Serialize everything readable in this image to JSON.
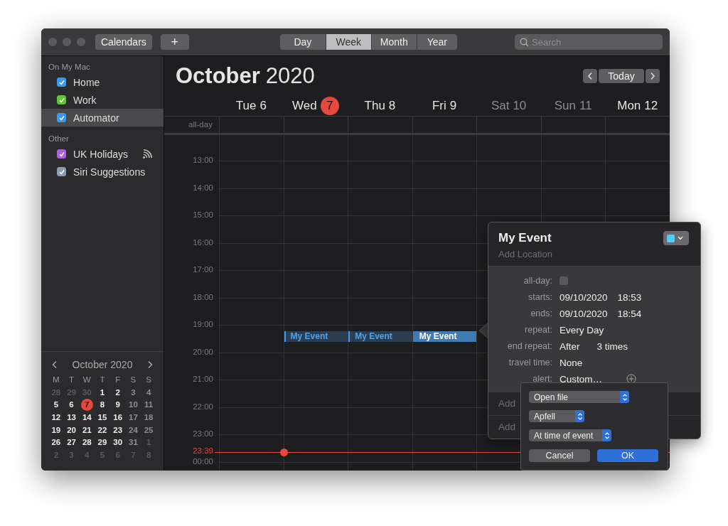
{
  "toolbar": {
    "calendars_button": "Calendars",
    "add_button": "+",
    "views": [
      {
        "label": "Day",
        "selected": false
      },
      {
        "label": "Week",
        "selected": true
      },
      {
        "label": "Month",
        "selected": false
      },
      {
        "label": "Year",
        "selected": false
      }
    ],
    "search": {
      "placeholder": "Search"
    }
  },
  "sidebar": {
    "groups": [
      {
        "title": "On My Mac",
        "items": [
          {
            "label": "Home",
            "color": "#3b99ee",
            "checked": true,
            "selected": false,
            "subscribed": false
          },
          {
            "label": "Work",
            "color": "#63c33a",
            "checked": true,
            "selected": false,
            "subscribed": false
          },
          {
            "label": "Automator",
            "color": "#3b99ee",
            "checked": true,
            "selected": true,
            "subscribed": false
          }
        ]
      },
      {
        "title": "Other",
        "items": [
          {
            "label": "UK Holidays",
            "color": "#b05fd6",
            "checked": true,
            "selected": false,
            "subscribed": true
          },
          {
            "label": "Siri Suggestions",
            "color": "#8d9ab3",
            "checked": true,
            "selected": false,
            "subscribed": false
          }
        ]
      }
    ]
  },
  "mini_calendar": {
    "title": "October 2020",
    "weekdays": [
      "M",
      "T",
      "W",
      "T",
      "F",
      "S",
      "S"
    ],
    "weeks": [
      [
        {
          "d": "28",
          "in_month": false,
          "today": false
        },
        {
          "d": "29",
          "in_month": false,
          "today": false
        },
        {
          "d": "30",
          "in_month": false,
          "today": false
        },
        {
          "d": "1",
          "in_month": true,
          "today": false
        },
        {
          "d": "2",
          "in_month": true,
          "today": false
        },
        {
          "d": "3",
          "in_month": true,
          "today": false
        },
        {
          "d": "4",
          "in_month": true,
          "today": false
        }
      ],
      [
        {
          "d": "5",
          "in_month": true,
          "today": false
        },
        {
          "d": "6",
          "in_month": true,
          "today": false
        },
        {
          "d": "7",
          "in_month": true,
          "today": true
        },
        {
          "d": "8",
          "in_month": true,
          "today": false
        },
        {
          "d": "9",
          "in_month": true,
          "today": false
        },
        {
          "d": "10",
          "in_month": true,
          "today": false
        },
        {
          "d": "11",
          "in_month": true,
          "today": false
        }
      ],
      [
        {
          "d": "12",
          "in_month": true,
          "today": false
        },
        {
          "d": "13",
          "in_month": true,
          "today": false
        },
        {
          "d": "14",
          "in_month": true,
          "today": false
        },
        {
          "d": "15",
          "in_month": true,
          "today": false
        },
        {
          "d": "16",
          "in_month": true,
          "today": false
        },
        {
          "d": "17",
          "in_month": true,
          "today": false
        },
        {
          "d": "18",
          "in_month": true,
          "today": false
        }
      ],
      [
        {
          "d": "19",
          "in_month": true,
          "today": false
        },
        {
          "d": "20",
          "in_month": true,
          "today": false
        },
        {
          "d": "21",
          "in_month": true,
          "today": false
        },
        {
          "d": "22",
          "in_month": true,
          "today": false
        },
        {
          "d": "23",
          "in_month": true,
          "today": false
        },
        {
          "d": "24",
          "in_month": true,
          "today": false
        },
        {
          "d": "25",
          "in_month": true,
          "today": false
        }
      ],
      [
        {
          "d": "26",
          "in_month": true,
          "today": false
        },
        {
          "d": "27",
          "in_month": true,
          "today": false
        },
        {
          "d": "28",
          "in_month": true,
          "today": false
        },
        {
          "d": "29",
          "in_month": true,
          "today": false
        },
        {
          "d": "30",
          "in_month": true,
          "today": false
        },
        {
          "d": "31",
          "in_month": true,
          "today": false
        },
        {
          "d": "1",
          "in_month": false,
          "today": false
        }
      ],
      [
        {
          "d": "2",
          "in_month": false,
          "today": false
        },
        {
          "d": "3",
          "in_month": false,
          "today": false
        },
        {
          "d": "4",
          "in_month": false,
          "today": false
        },
        {
          "d": "5",
          "in_month": false,
          "today": false
        },
        {
          "d": "6",
          "in_month": false,
          "today": false
        },
        {
          "d": "7",
          "in_month": false,
          "today": false
        },
        {
          "d": "8",
          "in_month": false,
          "today": false
        }
      ]
    ]
  },
  "header": {
    "month": "October",
    "year": "2020",
    "today_button": "Today"
  },
  "days": [
    {
      "name": "Tue",
      "date": "6",
      "today": false,
      "weekend": false
    },
    {
      "name": "Wed",
      "date": "7",
      "today": true,
      "weekend": false
    },
    {
      "name": "Thu",
      "date": "8",
      "today": false,
      "weekend": false
    },
    {
      "name": "Fri",
      "date": "9",
      "today": false,
      "weekend": false
    },
    {
      "name": "Sat",
      "date": "10",
      "today": false,
      "weekend": true
    },
    {
      "name": "Sun",
      "date": "11",
      "today": false,
      "weekend": true
    },
    {
      "name": "Mon",
      "date": "12",
      "today": false,
      "weekend": false
    }
  ],
  "all_day_label": "all-day",
  "hours": [
    {
      "label": "13:00"
    },
    {
      "label": "14:00"
    },
    {
      "label": "15:00"
    },
    {
      "label": "16:00"
    },
    {
      "label": "17:00"
    },
    {
      "label": "18:00"
    },
    {
      "label": "19:00",
      "slots": [
        {
          "kind": "empty"
        },
        {
          "kind": "event",
          "title": "My Event",
          "selected": false
        },
        {
          "kind": "event",
          "title": "My Event",
          "selected": false
        },
        {
          "kind": "event",
          "title": "My Event",
          "selected": true
        },
        {
          "kind": "empty"
        },
        {
          "kind": "empty"
        },
        {
          "kind": "empty"
        }
      ]
    },
    {
      "label": "20:00"
    },
    {
      "label": "21:00"
    },
    {
      "label": "22:00"
    },
    {
      "label": "23:00",
      "now": "23:39"
    },
    {
      "label": "00:00"
    }
  ],
  "popover": {
    "title": "My Event",
    "location_placeholder": "Add Location",
    "color": "#5ac8fa",
    "fields": [
      {
        "label": "all-day:",
        "kind": "checkbox",
        "checked": false
      },
      {
        "label": "starts:",
        "kind": "datetime",
        "date": "09/10/2020",
        "time": "18:53"
      },
      {
        "label": "ends:",
        "kind": "datetime",
        "date": "09/10/2020",
        "time": "18:54"
      },
      {
        "label": "repeat:",
        "kind": "text",
        "value": "Every Day"
      },
      {
        "label": "end repeat:",
        "kind": "pair",
        "value": "After",
        "extra": "3 times"
      },
      {
        "label": "travel time:",
        "kind": "text",
        "value": "None"
      },
      {
        "label": "alert:",
        "kind": "add",
        "value": "Custom…"
      }
    ],
    "footer_rows": [
      "Add",
      "Add"
    ]
  },
  "alert_popover": {
    "popups": [
      {
        "label": "Open file"
      },
      {
        "label": "Apfell"
      },
      {
        "label": "At time of event"
      }
    ],
    "buttons": [
      {
        "label": "Cancel",
        "default": false
      },
      {
        "label": "OK",
        "default": true
      }
    ]
  }
}
